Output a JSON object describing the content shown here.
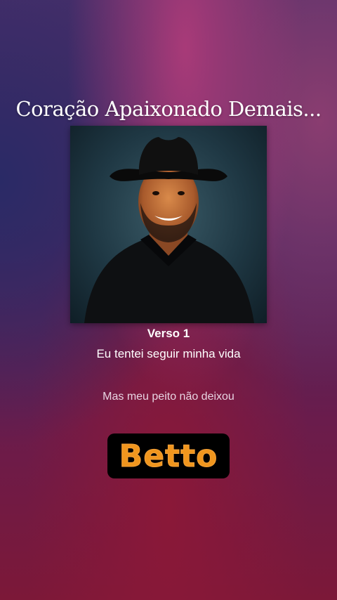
{
  "song": {
    "title": "Coração Apaixonado Demais..."
  },
  "cover": {
    "icon": "artist-portrait-cowboy-hat"
  },
  "lyrics": {
    "section_label": "Verso 1",
    "current_line": "Eu tentei seguir minha vida",
    "next_line": "Mas meu peito não deixou"
  },
  "brand": {
    "logo_text": "Betto",
    "logo_color": "#f0961e"
  }
}
